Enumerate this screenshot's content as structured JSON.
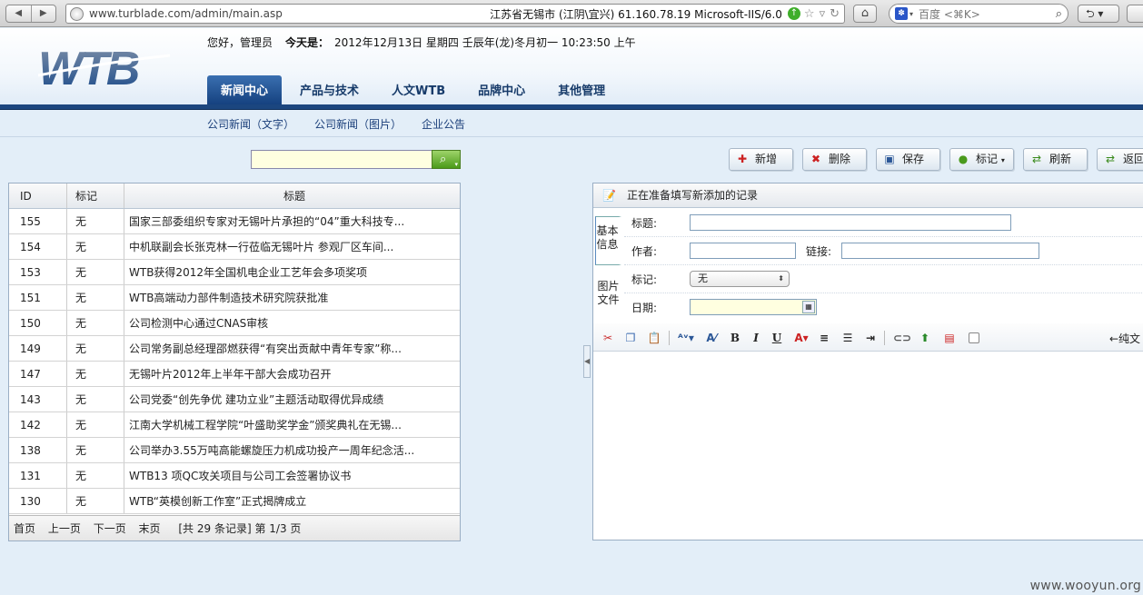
{
  "browser": {
    "url": "www.turblade.com/admin/main.asp",
    "server_info": "江苏省无锡市 (江阴\\宜兴)   61.160.78.19   Microsoft-IIS/6.0",
    "search_placeholder": "百度 <⌘K>",
    "back_icon": "back-arrow-icon",
    "forward_icon": "forward-arrow-icon",
    "home_icon": "home-icon"
  },
  "header": {
    "greeting": "您好，管理员",
    "today_label": "今天是：",
    "date_text": "2012年12月13日 星期四 壬辰年(龙)冬月初一 10:23:50 上午",
    "logo_text": "WTB",
    "tabs": [
      {
        "label": "新闻中心",
        "active": true
      },
      {
        "label": "产品与技术",
        "active": false
      },
      {
        "label": "人文WTB",
        "active": false
      },
      {
        "label": "品牌中心",
        "active": false
      },
      {
        "label": "其他管理",
        "active": false
      }
    ],
    "subnav": [
      "公司新闻（文字）",
      "公司新闻（图片）",
      "企业公告"
    ]
  },
  "search": {
    "value": ""
  },
  "toolbar": {
    "add": "新增",
    "delete": "删除",
    "save": "保存",
    "mark": "标记",
    "refresh": "刷新",
    "back": "返回"
  },
  "grid": {
    "headers": {
      "id": "ID",
      "mark": "标记",
      "title": "标题"
    },
    "rows": [
      {
        "id": "155",
        "mark": "无",
        "title": "国家三部委组织专家对无锡叶片承担的“04”重大科技专..."
      },
      {
        "id": "154",
        "mark": "无",
        "title": "中机联副会长张克林一行莅临无锡叶片 参观厂区车间..."
      },
      {
        "id": "153",
        "mark": "无",
        "title": "WTB获得2012年全国机电企业工艺年会多项奖项"
      },
      {
        "id": "151",
        "mark": "无",
        "title": "WTB高端动力部件制造技术研究院获批准"
      },
      {
        "id": "150",
        "mark": "无",
        "title": "公司检测中心通过CNAS审核"
      },
      {
        "id": "149",
        "mark": "无",
        "title": "公司常务副总经理邵燃获得“有突出贡献中青年专家”称..."
      },
      {
        "id": "147",
        "mark": "无",
        "title": "无锡叶片2012年上半年干部大会成功召开"
      },
      {
        "id": "143",
        "mark": "无",
        "title": "公司党委“创先争优 建功立业”主题活动取得优异成绩"
      },
      {
        "id": "142",
        "mark": "无",
        "title": "江南大学机械工程学院“叶盛助奖学金”颁奖典礼在无锡..."
      },
      {
        "id": "138",
        "mark": "无",
        "title": "公司举办3.55万吨高能螺旋压力机成功投产一周年纪念活..."
      },
      {
        "id": "131",
        "mark": "无",
        "title": "WTB13 项QC攻关项目与公司工会签署协议书"
      },
      {
        "id": "130",
        "mark": "无",
        "title": "WTB“英模创新工作室”正式揭牌成立"
      }
    ],
    "pager": {
      "first": "首页",
      "prev": "上一页",
      "next": "下一页",
      "last": "末页",
      "info": "[共 29 条记录]  第 1/3 页"
    }
  },
  "form": {
    "header": "正在准备填写新添加的记录",
    "tab_basic": "基本信息",
    "tab_image": "图片文件",
    "title_label": "标题:",
    "author_label": "作者:",
    "link_label": "链接:",
    "mark_label": "标记:",
    "mark_value": "无",
    "date_label": "日期:",
    "title_value": "",
    "author_value": "",
    "link_value": "",
    "date_value": "",
    "plain_text": "←纯文"
  },
  "watermark": "www.wooyun.org"
}
